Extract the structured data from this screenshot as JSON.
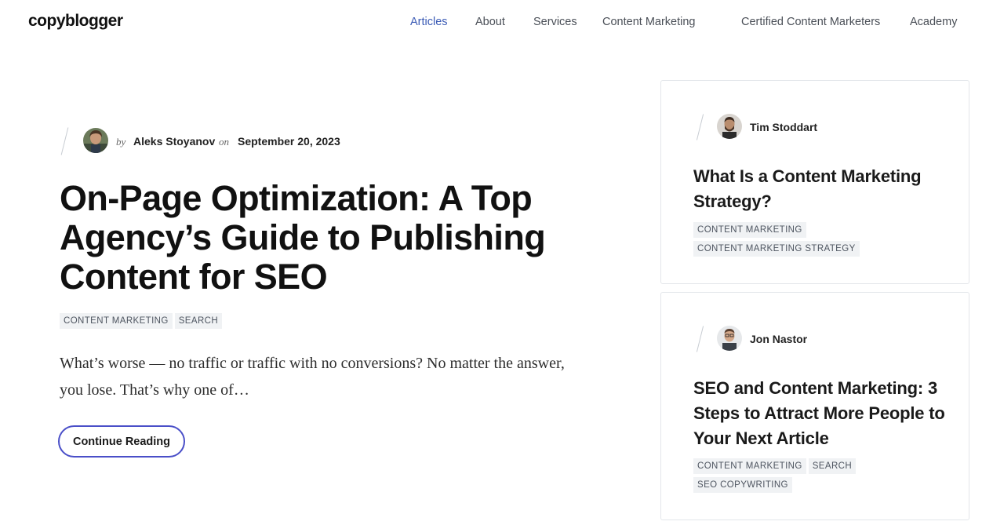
{
  "header": {
    "logo": "copyblogger",
    "nav": [
      "Articles",
      "About",
      "Services",
      "Content Marketing",
      "Certified Content Marketers",
      "Academy"
    ],
    "active_nav": "Articles"
  },
  "main": {
    "by": "by",
    "author": "Aleks Stoyanov",
    "on": "on",
    "date": "September 20, 2023",
    "title": "On-Page Optimization: A Top Agency’s Guide to Publishing Content for SEO",
    "tags": [
      "CONTENT MARKETING",
      "SEARCH"
    ],
    "excerpt": "What’s worse — no traffic or traffic with no conversions? No matter the answer, you lose. That’s why one of…",
    "cta": "Continue Reading"
  },
  "sidebar": {
    "cards": [
      {
        "author": "Tim Stoddart",
        "title": "What Is a Content Marketing Strategy?",
        "tags": [
          "CONTENT MARKETING",
          "CONTENT MARKETING STRATEGY"
        ]
      },
      {
        "author": "Jon Nastor",
        "title": "SEO and Content Marketing: 3 Steps to Attract More People to Your Next Article",
        "tags": [
          "CONTENT MARKETING",
          "SEARCH",
          "SEO COPYWRITING"
        ]
      }
    ]
  },
  "colors": {
    "accent": "#3b5bb5",
    "button_border": "#4a4fc8",
    "tag_bg": "#f0f2f4"
  }
}
